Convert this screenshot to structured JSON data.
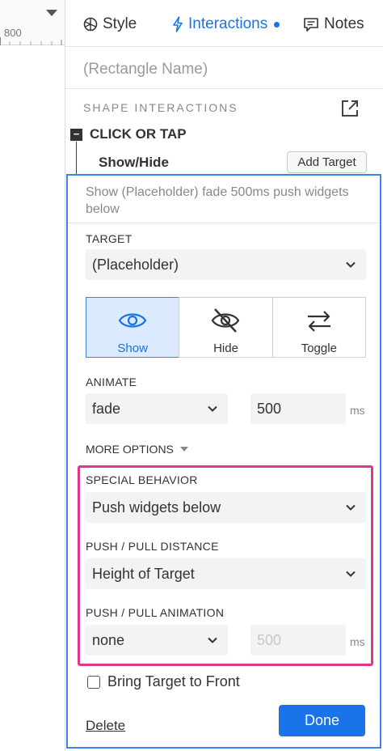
{
  "ruler": {
    "value": "800"
  },
  "tabs": [
    {
      "label": "Style",
      "icon": "style-icon"
    },
    {
      "label": "Interactions",
      "icon": "lightning-icon",
      "active": true
    },
    {
      "label": "Notes",
      "icon": "notes-icon"
    }
  ],
  "widget_name": {
    "placeholder": "(Rectangle Name)"
  },
  "shape_interactions": {
    "title": "SHAPE INTERACTIONS"
  },
  "event": {
    "label": "CLICK OR TAP",
    "collapse_symbol": "−"
  },
  "action": {
    "label": "Show/Hide",
    "add_target_label": "Add Target"
  },
  "editor": {
    "summary": "Show (Placeholder) fade 500ms push widgets below",
    "target": {
      "label": "TARGET",
      "value": "(Placeholder)"
    },
    "visibility": [
      {
        "label": "Show",
        "icon": "eye-icon",
        "selected": true
      },
      {
        "label": "Hide",
        "icon": "eye-off-icon",
        "selected": false
      },
      {
        "label": "Toggle",
        "icon": "toggle-arrows-icon",
        "selected": false
      }
    ],
    "animate": {
      "label": "ANIMATE",
      "value": "fade",
      "duration": "500",
      "unit": "ms"
    },
    "more_options": {
      "label": "MORE OPTIONS"
    },
    "special_behavior": {
      "label": "SPECIAL BEHAVIOR",
      "value": "Push widgets below"
    },
    "push_pull_distance": {
      "label": "PUSH / PULL DISTANCE",
      "value": "Height of Target"
    },
    "push_pull_animation": {
      "label": "PUSH / PULL ANIMATION",
      "value": "none",
      "duration": "500",
      "unit": "ms"
    },
    "bring_to_front": {
      "label": "Bring Target to Front",
      "checked": false
    },
    "delete_label": "Delete",
    "done_label": "Done"
  },
  "colors": {
    "accent": "#1a73e8",
    "highlight": "#e0368b",
    "selected_bg": "#dbeafe"
  }
}
